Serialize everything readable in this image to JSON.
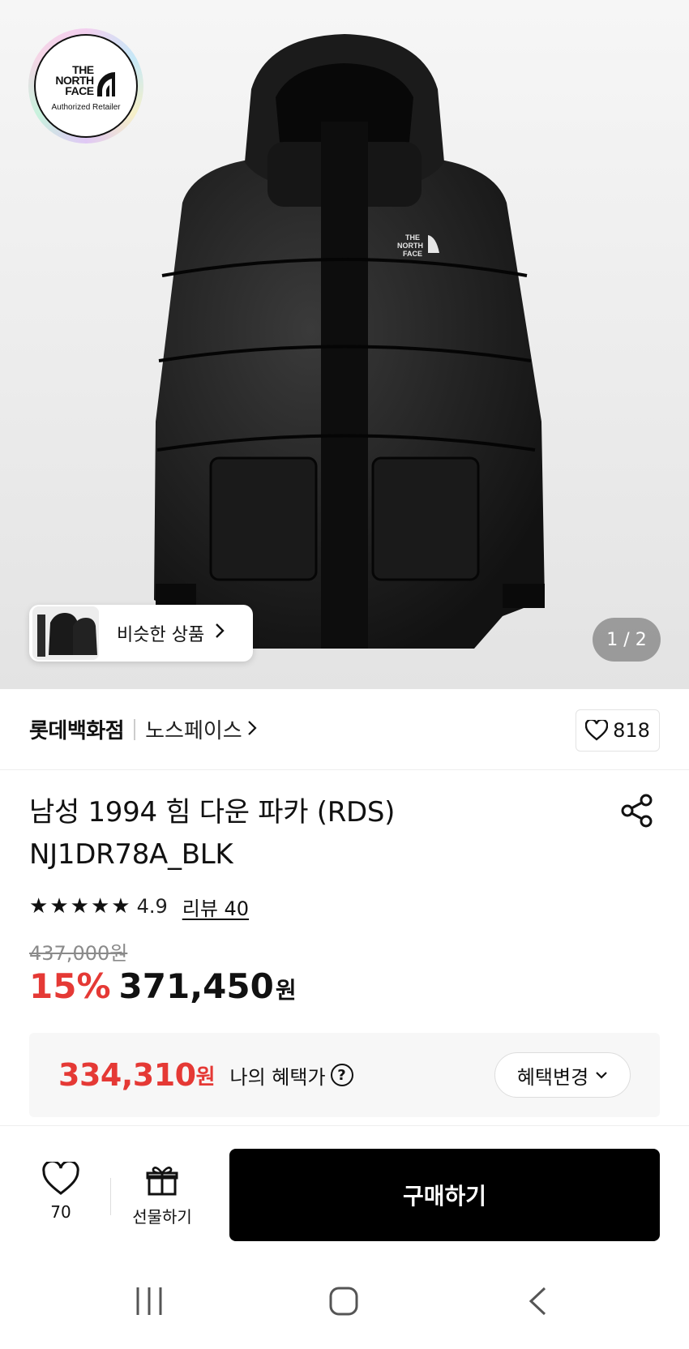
{
  "hero": {
    "badge_logo_lines": [
      "THE",
      "NORTH",
      "FACE"
    ],
    "badge_subtitle": "Authorized Retailer",
    "similar_label": "비슷한 상품",
    "pager": "1 / 2"
  },
  "store": {
    "name": "롯데백화점",
    "brand": "노스페이스",
    "like_count": "818"
  },
  "product": {
    "title_line1": "남성 1994 힘 다운 파카 (RDS)",
    "title_line2": "NJ1DR78A_BLK",
    "rating": "4.9",
    "stars": 5,
    "review_link": "리뷰 40",
    "original_price": "437,000원",
    "discount": "15%",
    "price": "371,450",
    "price_unit": "원"
  },
  "benefit": {
    "price": "334,310",
    "unit": "원",
    "label": "나의 혜택가",
    "help": "?",
    "change_button": "혜택변경"
  },
  "bottom_bar": {
    "wish_count": "70",
    "gift_label": "선물하기",
    "buy_label": "구매하기"
  },
  "colors": {
    "discount_red": "#e53935",
    "buy_button": "#000000"
  },
  "icons": [
    "heart-icon",
    "share-icon",
    "star-icon",
    "gift-icon",
    "question-icon",
    "chevron-right-icon",
    "chevron-down-icon",
    "recent-apps-icon",
    "home-icon",
    "back-icon"
  ]
}
